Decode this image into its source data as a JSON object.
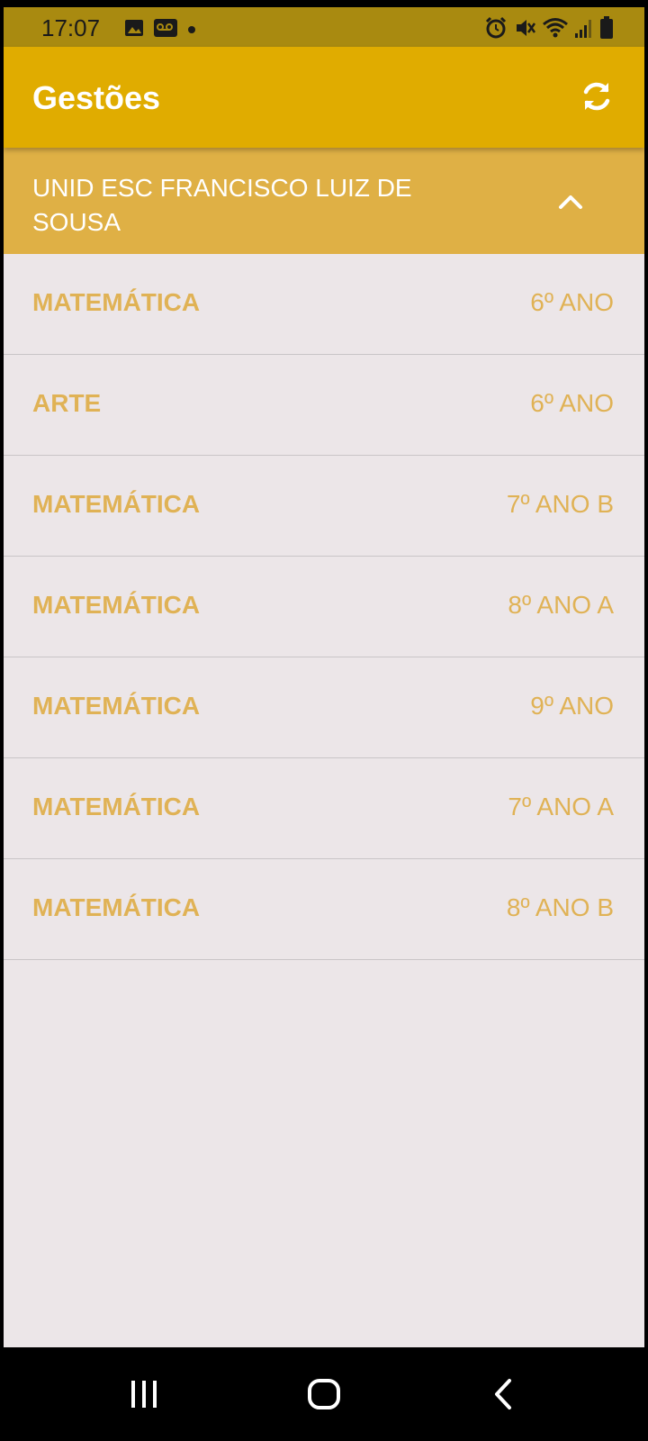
{
  "status_bar": {
    "time": "17:07",
    "left_icons": [
      "image-icon",
      "voicemail-icon",
      "dot-icon"
    ],
    "right_icons": [
      "alarm-icon",
      "mute-icon",
      "wifi-icon",
      "signal-icon",
      "battery-icon"
    ]
  },
  "app_bar": {
    "title": "Gestões",
    "refresh_icon": "refresh-icon"
  },
  "school": {
    "name": "UNID ESC FRANCISCO LUIZ DE SOUSA",
    "toggle_icon": "chevron-up-icon"
  },
  "items": [
    {
      "subject": "MATEMÁTICA",
      "class": "6º ANO"
    },
    {
      "subject": "ARTE",
      "class": "6º ANO"
    },
    {
      "subject": "MATEMÁTICA",
      "class": "7º ANO B"
    },
    {
      "subject": "MATEMÁTICA",
      "class": "8º ANO A"
    },
    {
      "subject": "MATEMÁTICA",
      "class": "9º ANO"
    },
    {
      "subject": "MATEMÁTICA",
      "class": "7º ANO A"
    },
    {
      "subject": "MATEMÁTICA",
      "class": "8º ANO B"
    }
  ],
  "nav_bar": {
    "buttons": [
      "recent-apps-icon",
      "home-icon",
      "back-icon"
    ]
  },
  "colors": {
    "status_bar": "#a98a10",
    "app_bar": "#e0ac00",
    "school_header": "#dfb045",
    "item_text": "#e0b255",
    "background": "#ece6e8"
  }
}
